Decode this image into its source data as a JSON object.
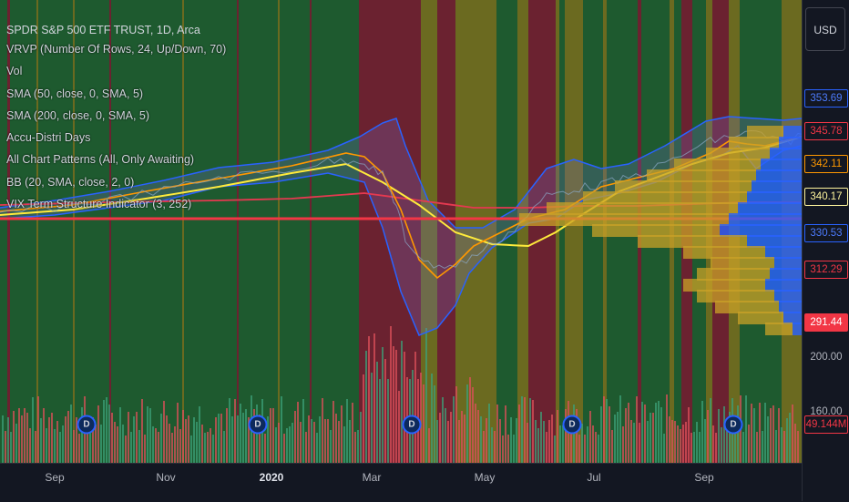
{
  "symbol": {
    "title": "SPDR S&P 500 ETF TRUST, 1D, Arca"
  },
  "indicators": [
    "VRVP (Number Of Rows, 24, Up/Down, 70)",
    "Vol",
    "SMA (50, close, 0, SMA, 5)",
    "SMA (200, close, 0, SMA, 5)",
    "Accu-Distri Days",
    "All Chart Patterns (All, Only Awaiting)",
    "BB (20, SMA, close, 2, 0)",
    "VIX Term Structure Indicator (3, 252)"
  ],
  "currency_button": "USD",
  "price_labels": [
    {
      "text": "353.69",
      "bg": "#131722",
      "fg": "#4d7cff",
      "border": "#2962ff"
    },
    {
      "text": "345.78",
      "bg": "#131722",
      "fg": "#f23645",
      "border": "#f23645"
    },
    {
      "text": "342.11",
      "bg": "#131722",
      "fg": "#ff9800",
      "border": "#ff9800"
    },
    {
      "text": "340.17",
      "bg": "#131722",
      "fg": "#fff59d",
      "border": "#fff59d"
    },
    {
      "text": "330.53",
      "bg": "#131722",
      "fg": "#4d7cff",
      "border": "#2962ff"
    },
    {
      "text": "312.29",
      "bg": "#131722",
      "fg": "#f23645",
      "border": "#f23645"
    },
    {
      "text": "291.44",
      "bg": "#f23645",
      "fg": "#ffffff",
      "border": "#f23645"
    },
    {
      "text": "49.144M",
      "bg": "#131722",
      "fg": "#f23645",
      "border": "#f23645"
    }
  ],
  "price_ticks": [
    "200.00",
    "160.00"
  ],
  "time_ticks": [
    {
      "label": "Sep",
      "bold": false
    },
    {
      "label": "Nov",
      "bold": false
    },
    {
      "label": "2020",
      "bold": true
    },
    {
      "label": "Mar",
      "bold": false
    },
    {
      "label": "May",
      "bold": false
    },
    {
      "label": "Jul",
      "bold": false
    },
    {
      "label": "Sep",
      "bold": false
    }
  ],
  "dividend_markers": [
    "D",
    "D",
    "D",
    "D",
    "D",
    "D"
  ],
  "colors": {
    "bull_bg": "#1e5a2f",
    "bear_bg": "#6b2230",
    "neutral_bg": "#6b6a20",
    "upper_bb": "#2962ff",
    "sma50": "#ff9800",
    "sma200": "#e53950",
    "ma_yellow": "#ffeb3b",
    "support_line": "#f23645",
    "vp_up": "#2962ff",
    "vp_down": "#c9a227"
  }
}
